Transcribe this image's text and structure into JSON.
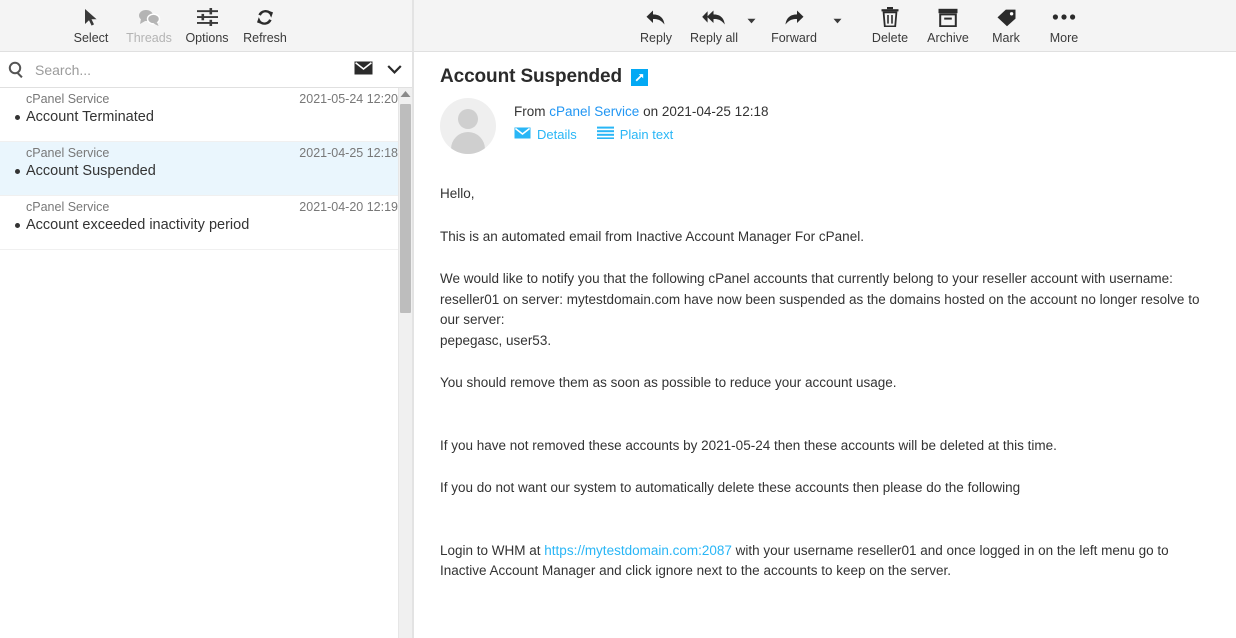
{
  "list_toolbar": {
    "buttons": [
      {
        "label": "Select",
        "icon": "cursor-arrow-icon",
        "disabled": false
      },
      {
        "label": "Threads",
        "icon": "threads-icon",
        "disabled": true
      },
      {
        "label": "Options",
        "icon": "sliders-icon",
        "disabled": false
      },
      {
        "label": "Refresh",
        "icon": "refresh-icon",
        "disabled": false
      }
    ]
  },
  "search": {
    "placeholder": "Search...",
    "value": "",
    "scope_icon": "envelope-icon",
    "dropdown_icon": "chevron-down-icon"
  },
  "message_list": {
    "items": [
      {
        "from": "cPanel Service",
        "date": "2021-05-24 12:20",
        "subject": "Account Terminated",
        "selected": false,
        "unread_dot": true
      },
      {
        "from": "cPanel Service",
        "date": "2021-04-25 12:18",
        "subject": "Account Suspended",
        "selected": true,
        "unread_dot": true
      },
      {
        "from": "cPanel Service",
        "date": "2021-04-20 12:19",
        "subject": "Account exceeded inactivity period",
        "selected": false,
        "unread_dot": true
      }
    ]
  },
  "message_toolbar": {
    "buttons": [
      {
        "label": "Reply",
        "icon": "reply-icon",
        "caret": false
      },
      {
        "label": "Reply all",
        "icon": "reply-all-icon",
        "caret": true
      },
      {
        "label": "Forward",
        "icon": "forward-icon",
        "caret": true
      },
      {
        "label": "Delete",
        "icon": "trash-icon",
        "caret": false
      },
      {
        "label": "Archive",
        "icon": "archive-box-icon",
        "caret": false
      },
      {
        "label": "Mark",
        "icon": "tag-icon",
        "caret": false
      },
      {
        "label": "More",
        "icon": "ellipsis-icon",
        "caret": false
      }
    ]
  },
  "message": {
    "subject": "Account Suspended",
    "open_in_window_icon": "external-link-icon",
    "from_prefix": "From",
    "from_name": "cPanel Service",
    "on_text": "on",
    "date": "2021-04-25 12:18",
    "details_label": "Details",
    "details_icon": "envelope-icon",
    "plain_text_label": "Plain text",
    "plain_text_icon": "list-lines-icon",
    "body": {
      "greeting": "Hello,",
      "para1": "This is an automated email from Inactive Account Manager For cPanel.",
      "para2": "We would like to notify you that the following cPanel accounts that currently belong to your reseller account with username: reseller01 on server: mytestdomain.com have now been suspended as the domains hosted on the account no longer resolve to our server:",
      "accounts": "pepegasc, user53.",
      "para3": "You should remove them as soon as possible to reduce your account usage.",
      "para4": "If you have not removed these accounts by 2021-05-24 then these accounts will be deleted at this time.",
      "para5": "If you do not want our system to automatically delete these accounts then please do the following",
      "para6_pre": "Login to WHM at ",
      "para6_link": "https://mytestdomain.com:2087",
      "para6_post": " with your username reseller01 and once logged in on the left menu go to Inactive Account Manager and click ignore next to the accounts to keep on the server."
    }
  },
  "colors": {
    "toolbar_bg": "#f4f4f4",
    "selected_row": "#eaf6fd",
    "link_blue": "#29b6f6",
    "accent_blue": "#03a9f4",
    "scrollbar_thumb": "#bdbdbd"
  }
}
